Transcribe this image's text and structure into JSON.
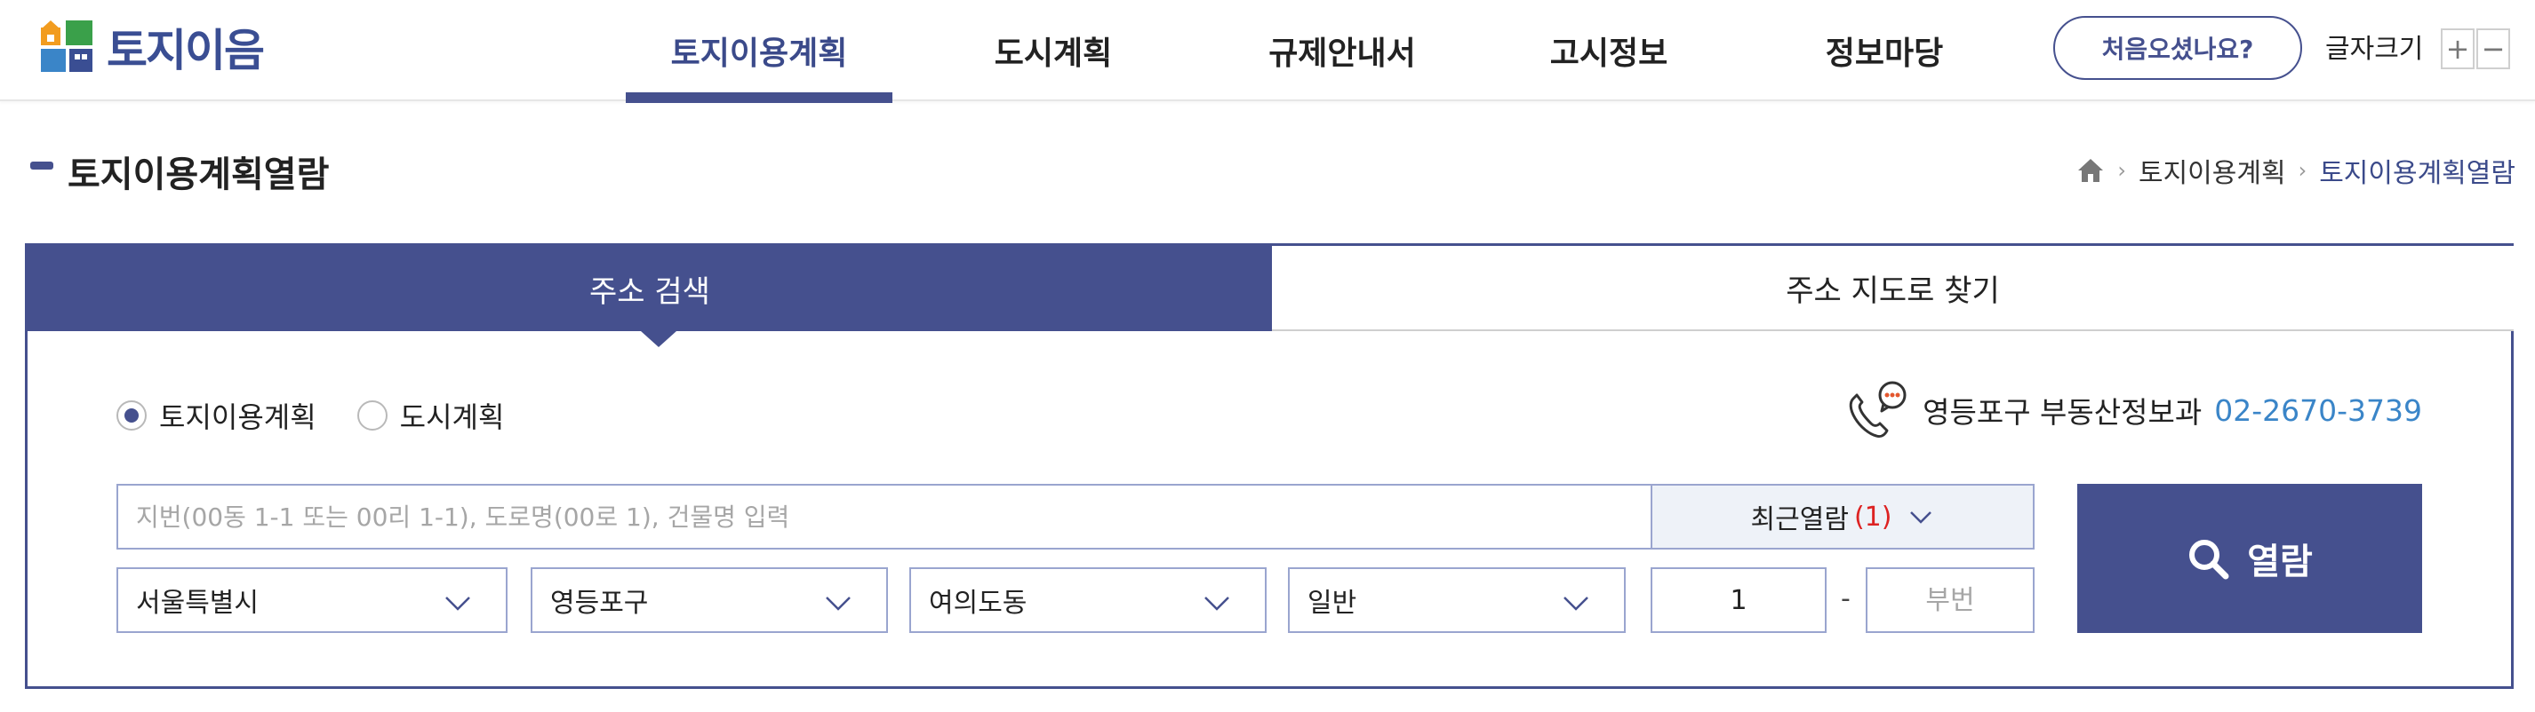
{
  "header": {
    "logo_text": "토지이음",
    "nav": [
      "토지이용계획",
      "도시계획",
      "규제안내서",
      "고시정보",
      "정보마당"
    ],
    "active_nav": "토지이용계획",
    "first_visit_label": "처음오셨나요?",
    "font_size_label": "글자크기",
    "font_plus": "+",
    "font_minus": "−"
  },
  "page": {
    "title": "토지이용계획열람",
    "breadcrumb": [
      "토지이용계획",
      "토지이용계획열람"
    ]
  },
  "tabs": [
    {
      "label": "주소 검색",
      "active": true
    },
    {
      "label": "주소 지도로 찾기",
      "active": false
    }
  ],
  "radio": [
    {
      "label": "토지이용계획",
      "checked": true
    },
    {
      "label": "도시계획",
      "checked": false
    }
  ],
  "contact": {
    "label": "영등포구 부동산정보과",
    "phone": "02-2670-3739"
  },
  "search": {
    "placeholder": "지번(00동 1-1 또는 00리 1-1), 도로명(00로 1), 건물명 입력",
    "recent_label": "최근열람",
    "recent_count": "(1)"
  },
  "selects": {
    "sido": "서울특별시",
    "sigungu": "영등포구",
    "dong": "여의도동",
    "type": "일반"
  },
  "lot": {
    "bon": "1",
    "dash": "-",
    "bu_placeholder": "부번"
  },
  "view_button": "열람",
  "colors": {
    "primary": "#45508e",
    "phone": "#3a85c8",
    "count": "#dd2222"
  }
}
